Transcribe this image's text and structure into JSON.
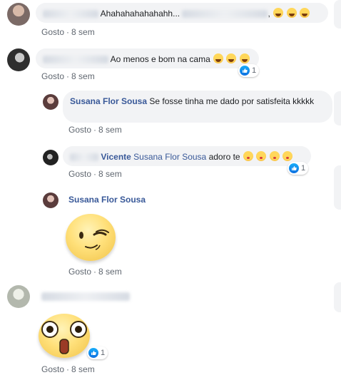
{
  "comments": [
    {
      "author": "",
      "text": "Ahahahahahahahh",
      "ellipsis": "...",
      "trailing": ",",
      "like_label": "Gosto",
      "time": "8 sem"
    },
    {
      "author": "",
      "text": "Ao menos e bom na cama",
      "like_label": "Gosto",
      "time": "8 sem",
      "reaction_count": "1"
    }
  ],
  "replies": [
    {
      "author": "Susana Flor Sousa",
      "text": "Se fosse tinha me dado por satisfeita kkkkk",
      "like_label": "Gosto",
      "time": "8 sem"
    },
    {
      "author_suffix": "Vicente",
      "mention": "Susana Flor Sousa",
      "text": "adoro te",
      "like_label": "Gosto",
      "time": "8 sem",
      "reaction_count": "1"
    },
    {
      "author": "Susana Flor Sousa",
      "sticker": "winking-face-sticker",
      "like_label": "Gosto",
      "time": "8 sem"
    }
  ],
  "last_comment": {
    "sticker": "shocked-face-sticker",
    "like_label": "Gosto",
    "time": "8 sem",
    "reaction_count": "1"
  },
  "separator": "·",
  "colors": {
    "bubble": "#f2f3f5",
    "name": "#385898",
    "meta": "#606770",
    "like_badge": "#1877f2"
  },
  "icons": [
    "laughing-emoji-icon",
    "kiss-emoji-icon",
    "like-reaction-icon"
  ]
}
